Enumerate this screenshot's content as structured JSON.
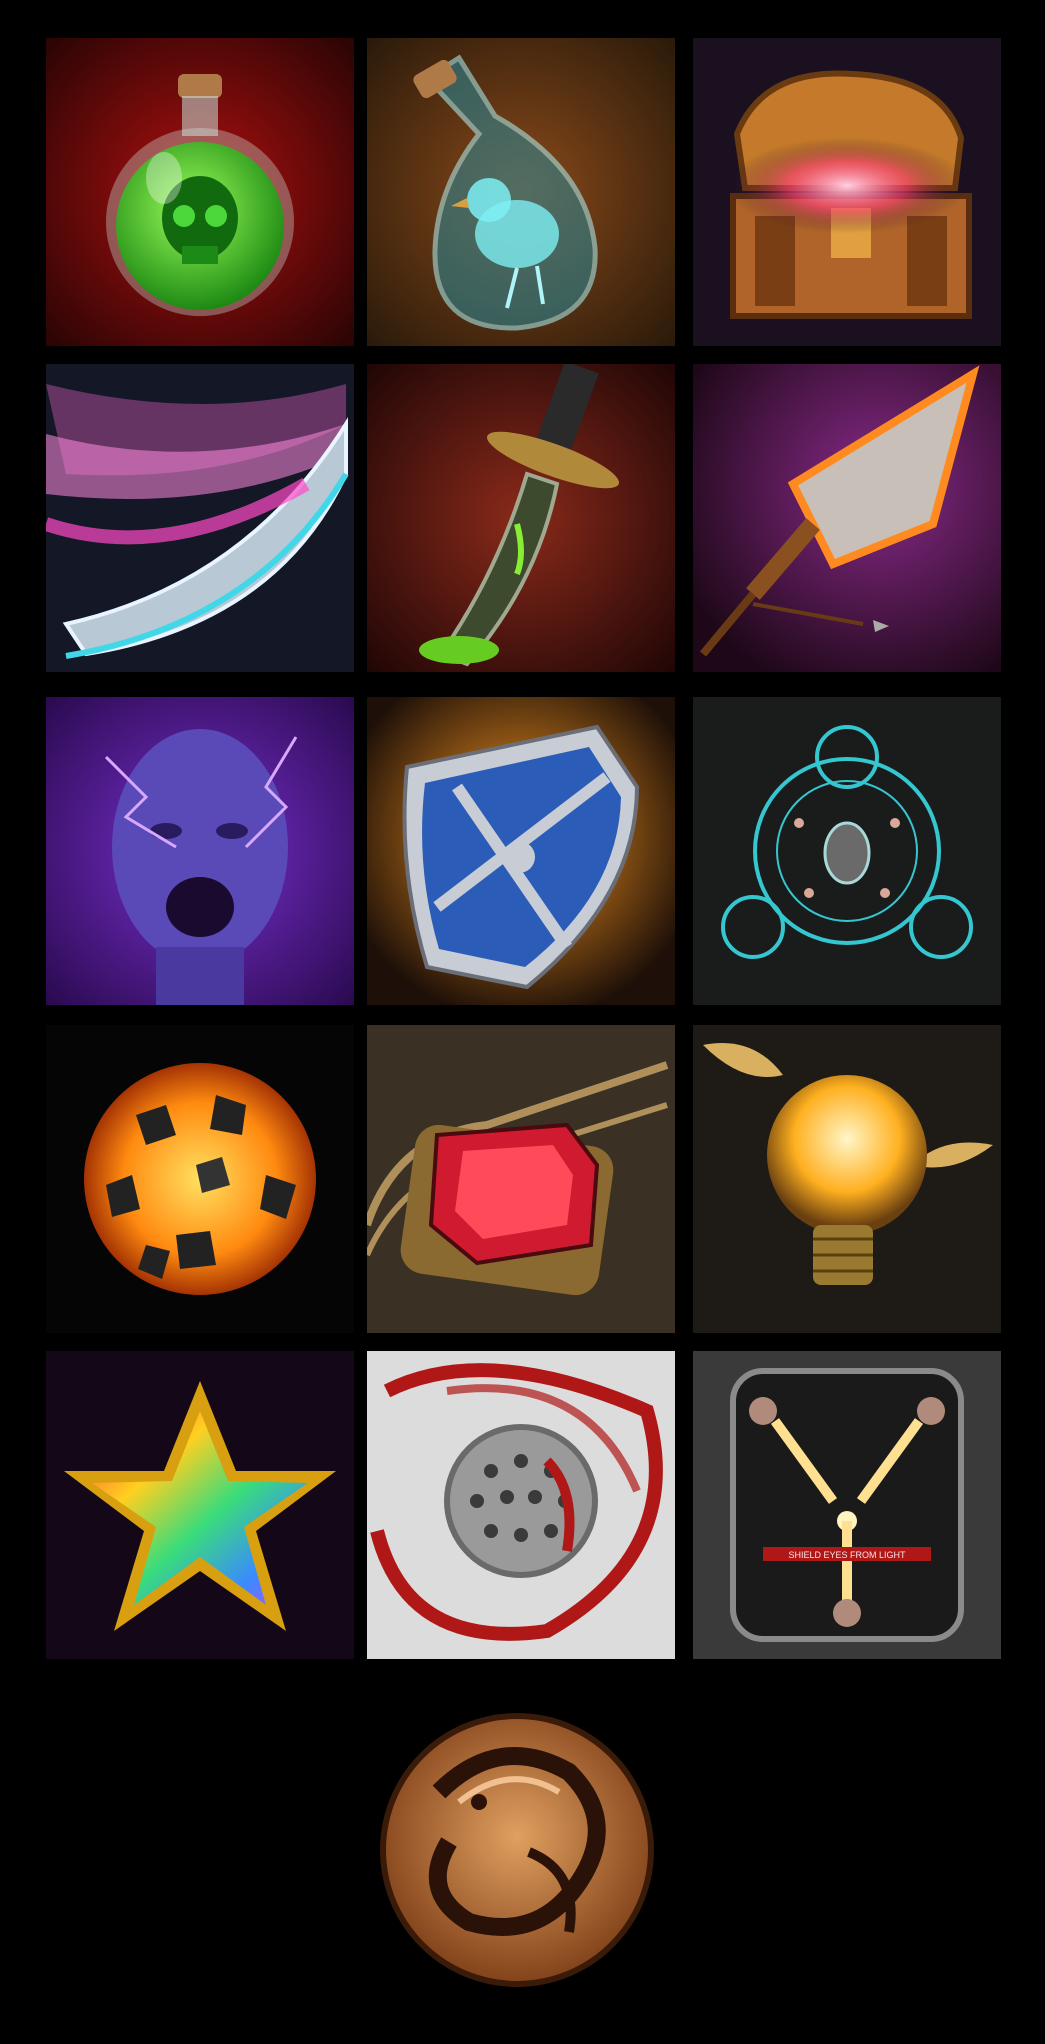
{
  "gallery": {
    "icons": [
      {
        "name": "poison-skull-potion-icon",
        "bg": "#5a0a0a",
        "accent": "#3cdc2a"
      },
      {
        "name": "bird-bottle-potion-icon",
        "bg": "#3a2610",
        "accent": "#5fe0e8"
      },
      {
        "name": "glowing-treasure-chest-icon",
        "bg": "#1a1020",
        "accent": "#ff5a8a"
      },
      {
        "name": "pink-slash-blade-icon",
        "bg": "#1a1a2a",
        "accent": "#ff6ad8"
      },
      {
        "name": "poison-dagger-icon",
        "bg": "#3a0c0c",
        "accent": "#66cc22"
      },
      {
        "name": "flaming-arrowhead-icon",
        "bg": "#2a0c2a",
        "accent": "#ff8a20"
      },
      {
        "name": "shocked-head-icon",
        "bg": "#3a1070",
        "accent": "#b85cff"
      },
      {
        "name": "blue-shield-icon",
        "bg": "#1e1008",
        "accent": "#2a5cb8"
      },
      {
        "name": "rune-circle-icon",
        "bg": "#0e1418",
        "accent": "#35c7d0"
      },
      {
        "name": "lava-ball-icon",
        "bg": "#050505",
        "accent": "#ffb020"
      },
      {
        "name": "red-gem-button-icon",
        "bg": "#2a2418",
        "accent": "#d01a30"
      },
      {
        "name": "winged-lightbulb-icon",
        "bg": "#1e1a16",
        "accent": "#ffd060"
      },
      {
        "name": "rainbow-star-icon",
        "bg": "#140818",
        "accent": "#ffd020"
      },
      {
        "name": "blood-drain-icon",
        "bg": "#dcdcdc",
        "accent": "#b01818"
      },
      {
        "name": "flux-capacitor-icon",
        "bg": "#2c2c2c",
        "accent": "#ffe090"
      }
    ],
    "panel_text": "SHIELD EYES FROM LIGHT",
    "medallion": {
      "name": "dragon-medallion-icon",
      "color": "#c07a3a"
    }
  }
}
